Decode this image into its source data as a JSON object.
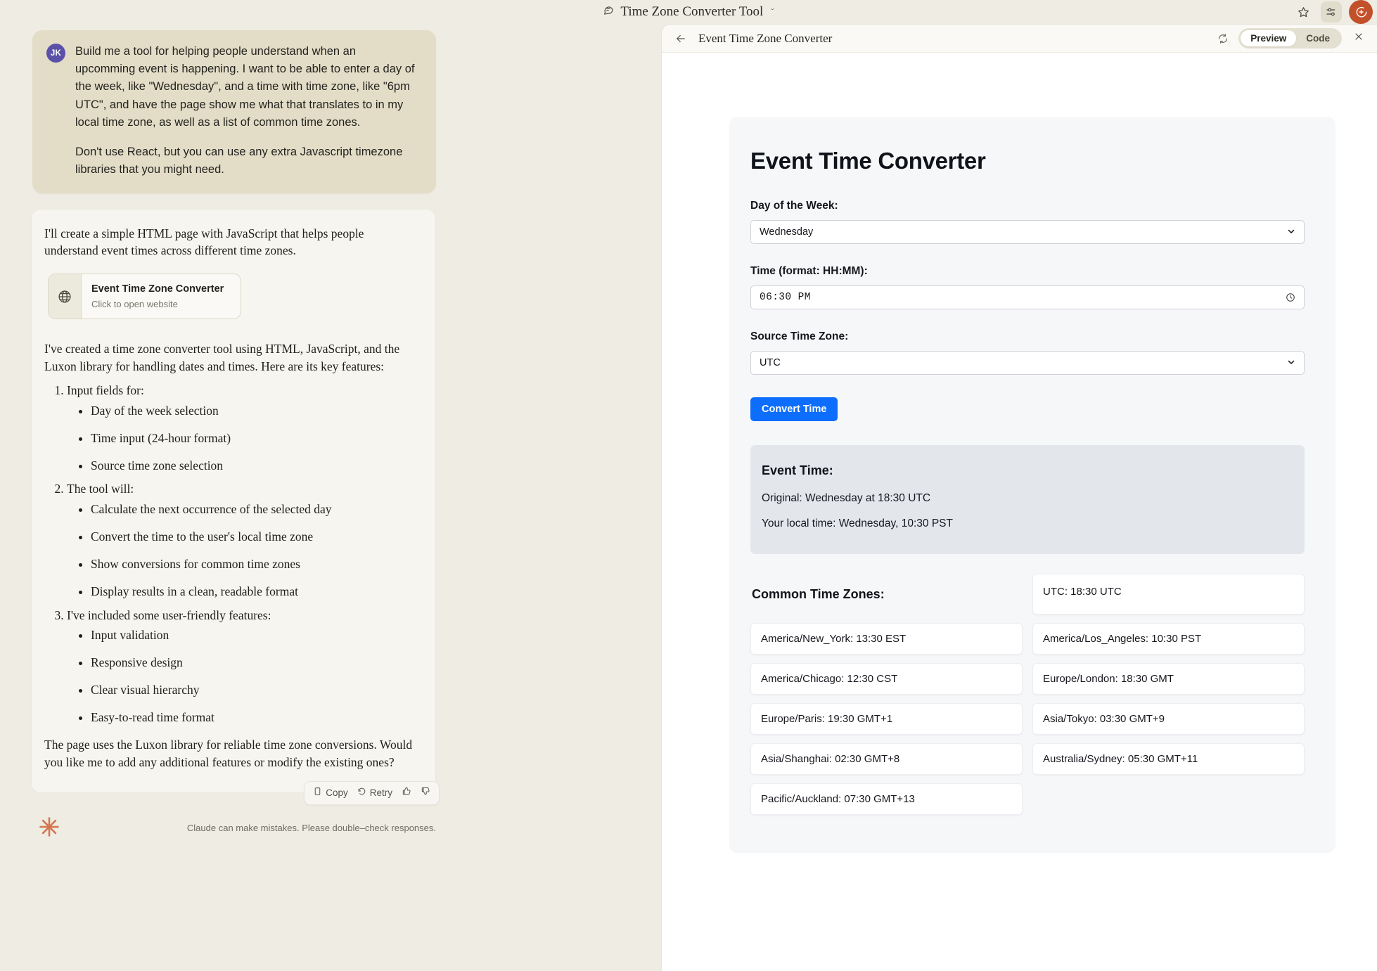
{
  "topbar": {
    "title": "Time Zone Converter Tool",
    "chat_icon": "chats-icon",
    "chevron": "ˇ",
    "star_icon": "star-icon",
    "settings_icon": "sliders-icon",
    "profile_icon": "new-chat-avatar-icon"
  },
  "conversation": {
    "user": {
      "initials": "JK",
      "paragraphs": [
        "Build me a tool  for helping people understand when an upcomming event is happening. I want to be able to enter a day of the week, like \"Wednesday\", and a time with time zone, like \"6pm UTC\", and have the page show me what that translates to in my local time zone, as well as a list of common time zones.",
        "Don't use React, but you can use any extra Javascript timezone libraries that you might need."
      ]
    },
    "assistant": {
      "intro": "I'll create a simple HTML page with JavaScript that helps people understand event times across different time zones.",
      "artifact": {
        "icon": "globe-icon",
        "title": "Event Time Zone Converter",
        "subtitle": "Click to open website"
      },
      "mid": "I've created a time zone converter tool using HTML, JavaScript, and the Luxon library for handling dates and times. Here are its key features:",
      "features": [
        {
          "label": "Input fields for:",
          "items": [
            "Day of the week selection",
            "Time input (24-hour format)",
            "Source time zone selection"
          ]
        },
        {
          "label": "The tool will:",
          "items": [
            "Calculate the next occurrence of the selected day",
            "Convert the time to the user's local time zone",
            "Show conversions for common time zones",
            "Display results in a clean, readable format"
          ]
        },
        {
          "label": "I've included some user-friendly features:",
          "items": [
            "Input validation",
            "Responsive design",
            "Clear visual hierarchy",
            "Easy-to-read time format"
          ]
        }
      ],
      "outro": "The page uses the Luxon library for reliable time zone conversions. Would you like me to add any additional features or modify the existing ones?",
      "actions": {
        "copy": "Copy",
        "retry": "Retry",
        "copy_icon": "clipboard-icon",
        "retry_icon": "refresh-icon",
        "thumbs_up_icon": "thumbs-up-icon",
        "thumbs_down_icon": "thumbs-down-icon"
      }
    },
    "footer": {
      "logo_icon": "claude-starburst-icon",
      "disclaimer": "Claude can make mistakes. Please double–check responses."
    }
  },
  "preview": {
    "back_icon": "arrow-left-icon",
    "title": "Event Time Zone Converter",
    "refresh_icon": "refresh-icon",
    "tabs": [
      {
        "label": "Preview",
        "active": true
      },
      {
        "label": "Code",
        "active": false
      }
    ],
    "close_icon": "close-icon"
  },
  "tool": {
    "title": "Event Time Converter",
    "day_label": "Day of the Week:",
    "day_value": "Wednesday",
    "time_label": "Time (format: HH:MM):",
    "time_value": "06:30  PM",
    "time_icon": "clock-icon",
    "tz_label": "Source Time Zone:",
    "tz_value": "UTC",
    "convert_button": "Convert Time",
    "dropdown_icon": "chevron-down-icon",
    "accent_color": "#0d6efd",
    "result": {
      "title": "Event Time:",
      "original": "Original: Wednesday at 18:30 UTC",
      "local": "Your local time: Wednesday, 10:30 PST"
    },
    "zones_heading": "Common Time Zones:",
    "zones": [
      "UTC: 18:30 UTC",
      "America/New_York: 13:30 EST",
      "America/Los_Angeles: 10:30 PST",
      "America/Chicago: 12:30 CST",
      "Europe/London: 18:30 GMT",
      "Europe/Paris: 19:30 GMT+1",
      "Asia/Tokyo: 03:30 GMT+9",
      "Asia/Shanghai: 02:30 GMT+8",
      "Australia/Sydney: 05:30 GMT+11",
      "Pacific/Auckland: 07:30 GMT+13"
    ]
  }
}
